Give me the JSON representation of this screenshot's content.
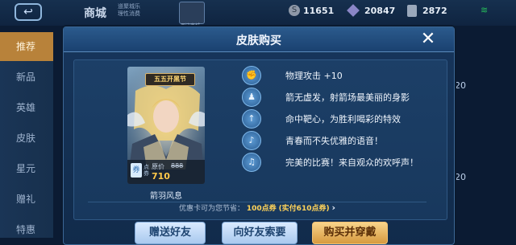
{
  "topbar": {
    "shop_title": "商城",
    "shop_sub_line1": "道聚城乐",
    "shop_sub_line2": "理性消费",
    "topicon_label": "周边商城",
    "coins": "11651",
    "diamonds": "20847",
    "tickets": "2872"
  },
  "sidebar": {
    "items": [
      {
        "label": "推荐"
      },
      {
        "label": "新品"
      },
      {
        "label": "英雄"
      },
      {
        "label": "皮肤"
      },
      {
        "label": "星元"
      },
      {
        "label": "赠礼"
      },
      {
        "label": "特惠"
      }
    ],
    "right_numbers": [
      "20",
      "20"
    ]
  },
  "dialog": {
    "title": "皮肤购买",
    "close_label": "✕",
    "card": {
      "banner": "五五开黑节",
      "points_label": "点券",
      "original_label": "原价",
      "original_price": "888",
      "sale_price": "710",
      "skin_name": "箭羽风息"
    },
    "features": [
      {
        "icon": "fist-icon",
        "glyph": "✊",
        "text": "物理攻击 +10"
      },
      {
        "icon": "hero-icon",
        "glyph": "♟",
        "text": "箭无虚发，射箭场最美丽的身影"
      },
      {
        "icon": "arrow-target-icon",
        "glyph": "↑",
        "text": "命中靶心，为胜利喝彩的特效"
      },
      {
        "icon": "voice-icon",
        "glyph": "♪",
        "text": "青春而不失优雅的语音！"
      },
      {
        "icon": "cheer-icon",
        "glyph": "♫",
        "text": "完美的比赛！来自观众的欢呼声！"
      }
    ],
    "discount": {
      "prefix": "优惠卡可为您节省：",
      "amount": "100点券",
      "actual": "(实付610点券)"
    },
    "buttons": {
      "gift": "赠送好友",
      "request": "向好友索要",
      "buy": "购买并穿戴"
    }
  },
  "colors": {
    "accent_gold": "#ffc94a",
    "dialog_bg": "#17365c",
    "button_gold": "#d79a3f"
  }
}
